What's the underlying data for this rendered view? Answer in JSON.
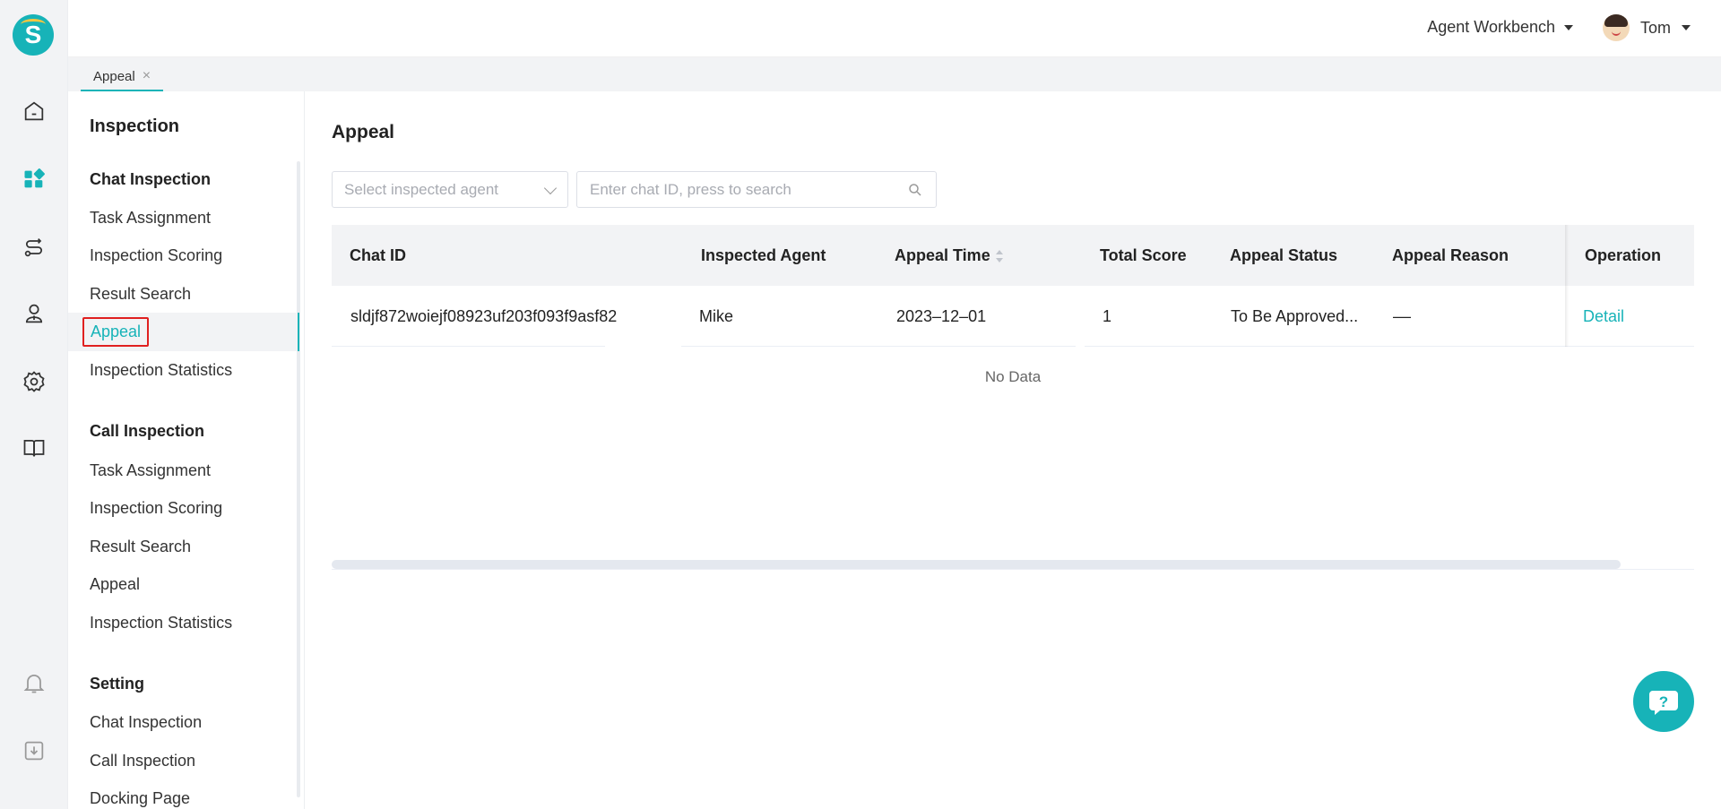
{
  "app": {
    "logo_letter": "S"
  },
  "rail": {
    "icons": [
      "home-icon",
      "dashboard-icon",
      "routing-icon",
      "agent-icon",
      "settings-icon",
      "book-icon",
      "bell-icon",
      "download-icon"
    ]
  },
  "topbar": {
    "workbench_label": "Agent Workbench",
    "user_name": "Tom"
  },
  "tabs": [
    {
      "label": "Appeal",
      "close": "×"
    }
  ],
  "sidebar": {
    "title": "Inspection",
    "groups": [
      {
        "title": "Chat Inspection",
        "items": [
          "Task Assignment",
          "Inspection Scoring",
          "Result Search",
          "Appeal",
          "Inspection Statistics"
        ]
      },
      {
        "title": "Call Inspection",
        "items": [
          "Task Assignment",
          "Inspection Scoring",
          "Result Search",
          "Appeal",
          "Inspection Statistics"
        ]
      },
      {
        "title": "Setting",
        "items": [
          "Chat Inspection",
          "Call Inspection",
          "Docking Page"
        ]
      }
    ]
  },
  "main": {
    "title": "Appeal",
    "agent_select_placeholder": "Select inspected agent",
    "search_placeholder": "Enter chat ID, press to search",
    "columns": [
      "Chat ID",
      "Inspected Agent",
      "Appeal Time",
      "Total Score",
      "Appeal Status",
      "Appeal Reason",
      "Operation"
    ],
    "rows": [
      {
        "chat_id": "sldjf872woiejf08923uf203f093f9asf82",
        "agent": "Mike",
        "appeal_time": "2023–12–01",
        "total_score": "1",
        "status": "To Be Approved...",
        "reason": "––",
        "operation": "Detail"
      }
    ],
    "empty_text": "No Data"
  },
  "colors": {
    "accent": "#17b3b8",
    "highlight_box": "#e02020"
  }
}
